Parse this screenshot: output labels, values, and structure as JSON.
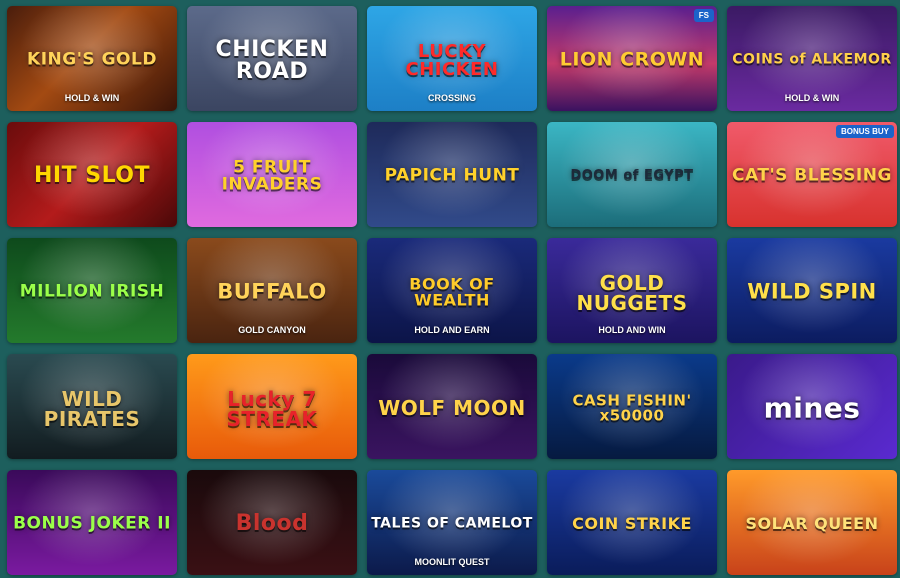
{
  "games": [
    {
      "title": "KING'S GOLD",
      "subtitle": "HOLD & WIN",
      "bg": "linear-gradient(135deg,#4a1d0c,#a34a12 45%,#3a1408)",
      "color": "#ffd35a",
      "size": "17px"
    },
    {
      "title": "CHICKEN ROAD",
      "subtitle": "",
      "bg": "linear-gradient(180deg,#5c6a8a,#3b4561)",
      "color": "#ffffff",
      "size": "22px"
    },
    {
      "title": "LUCKY CHICKEN",
      "subtitle": "CROSSING",
      "bg": "linear-gradient(180deg,#2ea6e6,#1d7fc6)",
      "color": "#ff2a2a",
      "size": "18px"
    },
    {
      "title": "LION CROWN",
      "subtitle": "",
      "bg": "linear-gradient(180deg,#5a1f8f,#c23a6a 55%,#3a1260)",
      "color": "#ffcc33",
      "size": "19px",
      "badge": "FS"
    },
    {
      "title": "COINS of ALKEMOR",
      "subtitle": "HOLD & WIN",
      "bg": "linear-gradient(180deg,#3b1a64,#6a2aa0)",
      "color": "#ffd04a",
      "size": "14px"
    },
    {
      "title": "HIT SLOT",
      "subtitle": "",
      "bg": "linear-gradient(135deg,#6a0c0c,#b31b1b 50%,#4a0808)",
      "color": "#ffd700",
      "size": "22px"
    },
    {
      "title": "5 FRUIT INVADERS",
      "subtitle": "",
      "bg": "linear-gradient(180deg,#b04fe0,#e06adf)",
      "color": "#ffd12b",
      "size": "17px"
    },
    {
      "title": "PAPICH HUNT",
      "subtitle": "",
      "bg": "linear-gradient(180deg,#1e2a5a,#314a8a)",
      "color": "#ffd12b",
      "size": "17px"
    },
    {
      "title": "DOOM of EGYPT",
      "subtitle": "",
      "bg": "linear-gradient(180deg,#3bb6c4,#1c6d7a)",
      "color": "#1d2a3a",
      "size": "13px"
    },
    {
      "title": "CAT'S BLESSING",
      "subtitle": "",
      "bg": "linear-gradient(180deg,#f05a6a,#d8322e)",
      "color": "#ffd34a",
      "size": "17px",
      "badge": "BONUS BUY"
    },
    {
      "title": "MILLION IRISH",
      "subtitle": "",
      "bg": "linear-gradient(180deg,#0e4a1c,#247a2c)",
      "color": "#9bff4a",
      "size": "17px"
    },
    {
      "title": "BUFFALO",
      "subtitle": "GOLD CANYON",
      "bg": "linear-gradient(180deg,#8a4a1c,#4a2410)",
      "color": "#ffd35a",
      "size": "21px"
    },
    {
      "title": "BOOK OF WEALTH",
      "subtitle": "HOLD AND EARN",
      "bg": "linear-gradient(180deg,#1a2a7a,#0c1448)",
      "color": "#ffcc2a",
      "size": "16px"
    },
    {
      "title": "GOLD NUGGETS",
      "subtitle": "HOLD AND WIN",
      "bg": "linear-gradient(180deg,#3a2a9a,#1c1460)",
      "color": "#ffe04a",
      "size": "20px"
    },
    {
      "title": "WILD SPIN",
      "subtitle": "",
      "bg": "linear-gradient(180deg,#1a3aa0,#0c1c60)",
      "color": "#ffe04a",
      "size": "21px"
    },
    {
      "title": "WILD PIRATES",
      "subtitle": "",
      "bg": "linear-gradient(180deg,#2a4a50,#121c20)",
      "color": "#e8c66a",
      "size": "20px"
    },
    {
      "title": "Lucky 7 STREAK",
      "subtitle": "",
      "bg": "linear-gradient(180deg,#ff9a1a,#e85a0a)",
      "color": "#e8222a",
      "size": "20px"
    },
    {
      "title": "WOLF MOON",
      "subtitle": "",
      "bg": "linear-gradient(180deg,#1a0a3a,#3a1460)",
      "color": "#ffd34a",
      "size": "20px"
    },
    {
      "title": "CASH FISHIN' x50000",
      "subtitle": "",
      "bg": "linear-gradient(180deg,#0a3a8a,#061a40)",
      "color": "#ffd34a",
      "size": "15px"
    },
    {
      "title": "mines",
      "subtitle": "",
      "bg": "linear-gradient(135deg,#3a1a8a,#5a2ad0)",
      "color": "#ffffff",
      "size": "28px"
    },
    {
      "title": "BONUS JOKER II",
      "subtitle": "",
      "bg": "linear-gradient(180deg,#3a0a5a,#7a1aa0)",
      "color": "#9bff4a",
      "size": "17px"
    },
    {
      "title": "Blood",
      "subtitle": "",
      "bg": "linear-gradient(180deg,#1a0a0c,#3a1014)",
      "color": "#c9332e",
      "size": "22px"
    },
    {
      "title": "TALES OF CAMELOT",
      "subtitle": "MOONLIT QUEST",
      "bg": "linear-gradient(180deg,#1a4a9a,#0c1a4a)",
      "color": "#ffffff",
      "size": "14px"
    },
    {
      "title": "COIN STRIKE",
      "subtitle": "",
      "bg": "linear-gradient(180deg,#1a3aa0,#0a1c5a)",
      "color": "#ffd34a",
      "size": "16px"
    },
    {
      "title": "SOLAR QUEEN",
      "subtitle": "",
      "bg": "linear-gradient(180deg,#ff9a2a,#c8421a)",
      "color": "#ffe27a",
      "size": "16px"
    }
  ]
}
